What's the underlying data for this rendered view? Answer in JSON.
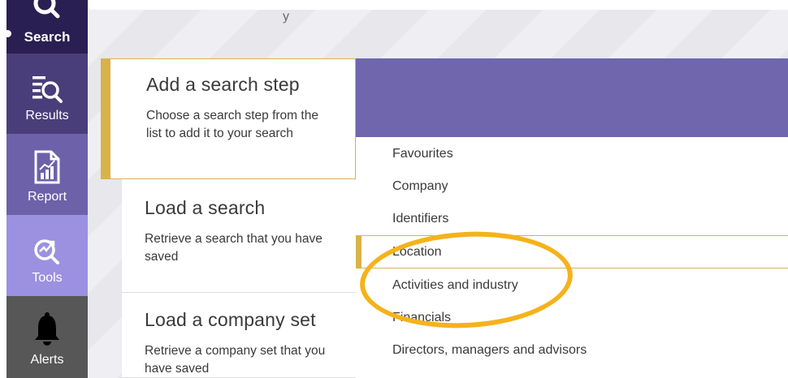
{
  "nav": {
    "items": [
      {
        "label": "Search",
        "icon": "search-icon"
      },
      {
        "label": "Results",
        "icon": "results-list-icon"
      },
      {
        "label": "Report",
        "icon": "report-chart-icon"
      },
      {
        "label": "Tools",
        "icon": "tools-target-icon"
      },
      {
        "label": "Alerts",
        "icon": "bell-icon"
      }
    ]
  },
  "background_text": "y",
  "options": [
    {
      "title": "Add a search step",
      "desc": "Choose a search step from the list to add it to your search"
    },
    {
      "title": "Load a search",
      "desc": "Retrieve a search that you have saved"
    },
    {
      "title": "Load a company set",
      "desc": "Retrieve a company set that you have saved"
    }
  ],
  "steps": [
    "Favourites",
    "Company",
    "Identifiers",
    "Location",
    "Activities and industry",
    "Financials",
    "Directors, managers and advisors"
  ],
  "colors": {
    "accent": "#d9b24a",
    "purple_header": "#6f66ad",
    "highlight": "#f5b21a"
  }
}
